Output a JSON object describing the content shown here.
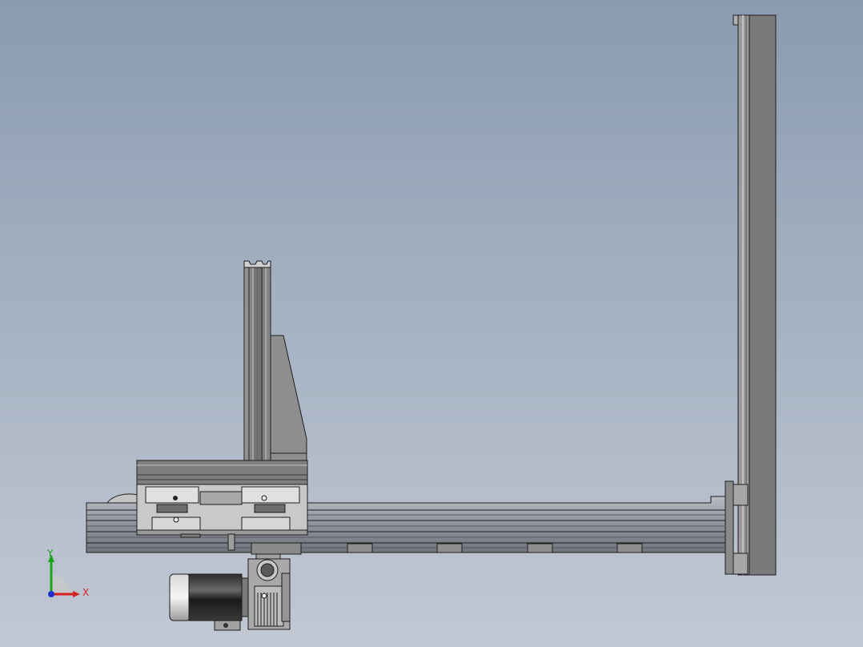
{
  "triad": {
    "y_label": "Y",
    "x_label": "X",
    "x_color": "#d62020",
    "y_color": "#1aa51a",
    "z_color": "#1f2fcf"
  },
  "colors": {
    "background_top": "#8a9bb0",
    "background_bottom": "#c2c8d4",
    "metal_dark": "#5a5a5a",
    "metal_mid": "#8c8c8c",
    "metal_light": "#b9b9b9",
    "outline": "#1e1e1e"
  }
}
